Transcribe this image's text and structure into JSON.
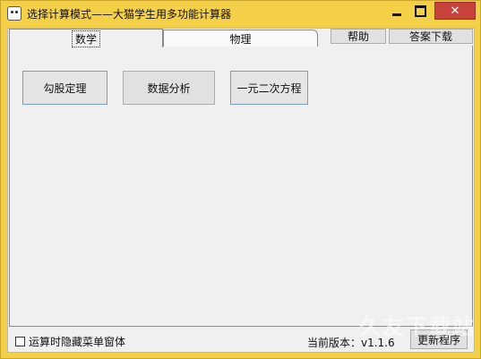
{
  "window": {
    "title": "选择计算模式——大猫学生用多功能计算器",
    "minimize_glyph": "",
    "close_glyph": "✕"
  },
  "tabs": [
    {
      "label": "数学",
      "active": true
    },
    {
      "label": "物理",
      "active": false
    }
  ],
  "top_buttons": {
    "help": "帮助",
    "download": "答案下载"
  },
  "math_panel": {
    "buttons": [
      "勾股定理",
      "数据分析",
      "一元二次方程"
    ]
  },
  "status_bar": {
    "hide_checkbox_label": "运算时隐藏菜单窗体",
    "hide_checkbox_checked": false,
    "version_label": "当前版本：v1.1.6",
    "update_button": "更新程序"
  },
  "watermark": "久友下载站",
  "colors": {
    "frame": "#f4cf48",
    "close_button": "#c7423a",
    "client_bg": "#f0f0f0"
  },
  "icons": {
    "app": "cat-app-icon",
    "minimize": "minimize-icon",
    "maximize": "maximize-icon",
    "close": "close-icon"
  }
}
